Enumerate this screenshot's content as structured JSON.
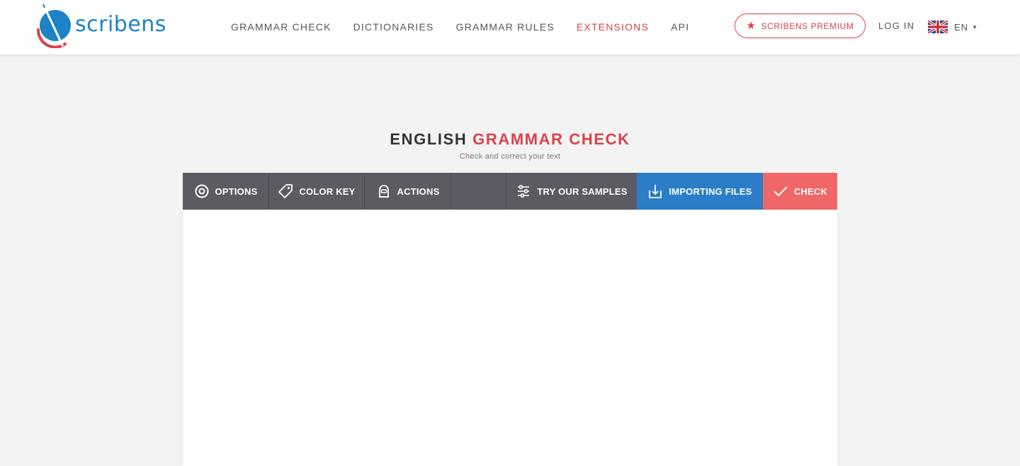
{
  "header": {
    "logo_text": "scribens",
    "nav": [
      {
        "label": "Grammar Check",
        "active": false
      },
      {
        "label": "Dictionaries",
        "active": false
      },
      {
        "label": "Grammar Rules",
        "active": false
      },
      {
        "label": "Extensions",
        "active": true
      },
      {
        "label": "API",
        "active": false
      }
    ],
    "premium_label": "Scribens Premium",
    "login_label": "Log in",
    "language_code": "EN"
  },
  "main": {
    "title_part1": "ENGLISH",
    "title_part2": "GRAMMAR CHECK",
    "subtitle": "Check and correct your text"
  },
  "toolbar": {
    "options": "Options",
    "color_key": "Color Key",
    "actions": "Actions",
    "samples": "Try our samples",
    "importing": "Importing files",
    "check": "Check"
  },
  "editor": {
    "value": "",
    "placeholder": ""
  },
  "colors": {
    "brand_blue": "#1d82c6",
    "accent_red": "#d94249",
    "toolbar_gray": "#5b5c63",
    "import_blue": "#2a7dc6",
    "check_red": "#f06767"
  },
  "icons": {
    "logo": "scribens-logo-icon",
    "premium": "star-icon",
    "language": "uk-flag-icon",
    "options": "gear-icon",
    "color_key": "tag-icon",
    "actions": "robot-icon",
    "samples": "sliders-icon",
    "importing": "download-icon",
    "check": "checkmark-icon"
  }
}
